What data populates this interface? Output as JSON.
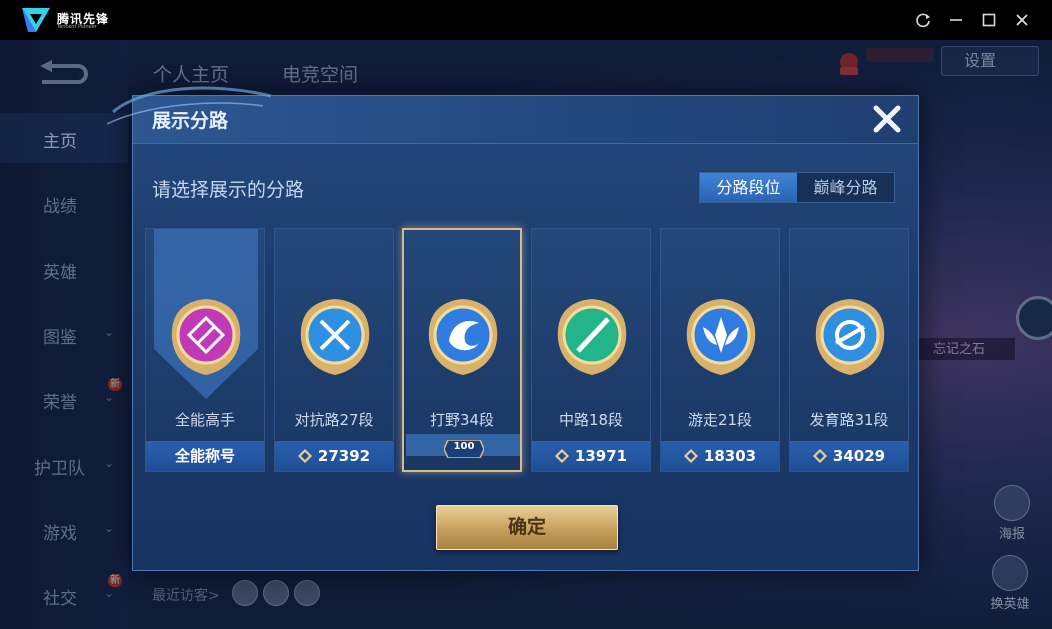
{
  "app": {
    "name": "腾讯先锋",
    "subtitle": "Tencent Pioneer"
  },
  "window_controls": [
    "restore-icon",
    "minimize-icon",
    "maximize-icon",
    "close-icon"
  ],
  "game": {
    "top_tabs": [
      "个人主页",
      "电竞空间"
    ],
    "settings_label": "设置",
    "sidebar": [
      {
        "label": "主页",
        "chevron": false,
        "new": false,
        "active": true
      },
      {
        "label": "战绩",
        "chevron": false,
        "new": false
      },
      {
        "label": "英雄",
        "chevron": false,
        "new": false
      },
      {
        "label": "图鉴",
        "chevron": true,
        "new": false
      },
      {
        "label": "荣誉",
        "chevron": true,
        "new": true
      },
      {
        "label": "护卫队",
        "chevron": true,
        "new": false
      },
      {
        "label": "游戏",
        "chevron": true,
        "new": false
      },
      {
        "label": "社交",
        "chevron": true,
        "new": true
      }
    ],
    "new_badge": "新",
    "recent_visitors_label": "最近访客>",
    "right_label": "忘记之石",
    "corner_buttons": [
      {
        "label": "海报"
      },
      {
        "label": "换英雄"
      }
    ]
  },
  "modal": {
    "title": "展示分路",
    "prompt": "请选择展示的分路",
    "segments": [
      {
        "label": "分路段位",
        "active": true
      },
      {
        "label": "巅峰分路",
        "active": false
      }
    ],
    "cards": [
      {
        "label": "全能高手",
        "footer": "全能称号",
        "has_points": false,
        "selected": false,
        "emblem": "all-round-emblem",
        "color": "#c03ab8"
      },
      {
        "label": "对抗路27段",
        "footer": "27392",
        "has_points": true,
        "selected": false,
        "emblem": "clash-lane-emblem",
        "color": "#2f8fe0"
      },
      {
        "label": "打野34段",
        "footer": "100",
        "has_points": false,
        "selected": true,
        "emblem": "jungle-emblem",
        "color": "#2f7de0"
      },
      {
        "label": "中路18段",
        "footer": "13971",
        "has_points": true,
        "selected": false,
        "emblem": "mid-lane-emblem",
        "color": "#22b58a"
      },
      {
        "label": "游走21段",
        "footer": "18303",
        "has_points": true,
        "selected": false,
        "emblem": "roam-emblem",
        "color": "#2f7de0"
      },
      {
        "label": "发育路31段",
        "footer": "34029",
        "has_points": true,
        "selected": false,
        "emblem": "farm-lane-emblem",
        "color": "#2f8fe0"
      }
    ],
    "confirm_label": "确定"
  }
}
